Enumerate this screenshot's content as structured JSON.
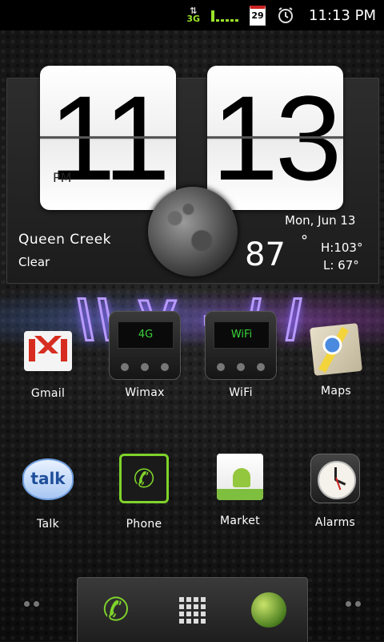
{
  "status_bar": {
    "network": "3G",
    "calendar_day": "29",
    "time": "11:13 PM",
    "icons": [
      "data-arrows-icon",
      "signal-icon",
      "calendar-icon",
      "alarm-clock-icon"
    ]
  },
  "clock_widget": {
    "hour": "11",
    "minute": "13",
    "ampm": "PM",
    "location": "Queen Creek",
    "condition": "Clear",
    "date": "Mon, Jun 13",
    "temperature": "87",
    "degree_symbol": "°",
    "high": "H:103°",
    "low": "L: 67°"
  },
  "apps_row1": [
    {
      "label": "Gmail",
      "icon": "gmail-icon"
    },
    {
      "label": "Wimax",
      "icon": "wimax-toggle-icon",
      "screen": "4G"
    },
    {
      "label": "WiFi",
      "icon": "wifi-toggle-icon",
      "screen": "WiFi"
    },
    {
      "label": "Maps",
      "icon": "maps-icon"
    }
  ],
  "apps_row2": [
    {
      "label": "Talk",
      "icon": "talk-icon",
      "glyph": "talk"
    },
    {
      "label": "Phone",
      "icon": "phone-icon"
    },
    {
      "label": "Market",
      "icon": "market-icon"
    },
    {
      "label": "Alarms",
      "icon": "alarms-icon"
    }
  ],
  "dock": {
    "items": [
      "phone-icon",
      "app-drawer-icon",
      "browser-globe-icon"
    ]
  },
  "colors": {
    "accent_green": "#7fd32a",
    "status_green": "#9be32a"
  }
}
